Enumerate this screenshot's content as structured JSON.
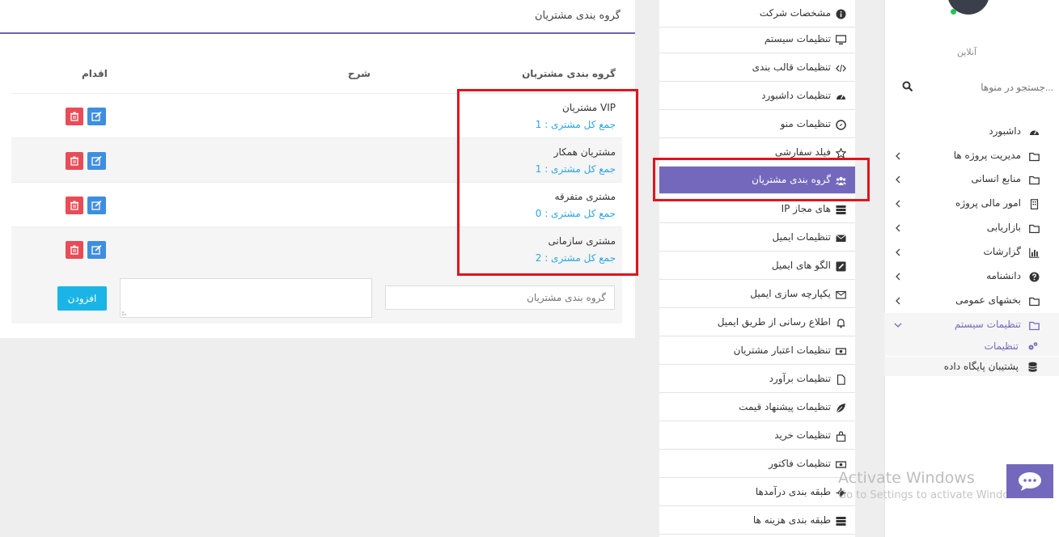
{
  "panel": {
    "title": "گروه بندی مشتریان",
    "columns": {
      "group": "گروه بندی مشتریان",
      "description": "شرح",
      "action": "اقدام"
    },
    "rows": [
      {
        "name": "مشتریان VIP",
        "count": "جمع کل مشتری : 1"
      },
      {
        "name": "مشتریان همکار",
        "count": "جمع کل مشتری : 1"
      },
      {
        "name": "مشتری متفرقه",
        "count": "جمع کل مشتری : 0"
      },
      {
        "name": "مشتری سازمانی",
        "count": "جمع کل مشتری : 2"
      }
    ],
    "form": {
      "name_placeholder": "گروه بندی مشتریان",
      "add_label": "افزودن"
    }
  },
  "settings_menu": {
    "items": [
      {
        "label": "مشخصات شرکت",
        "icon": "info-icon"
      },
      {
        "label": "تنظیمات سیستم",
        "icon": "monitor-icon"
      },
      {
        "label": "تنظیمات قالب بندی",
        "icon": "code-icon"
      },
      {
        "label": "تنظیمات داشبورد",
        "icon": "dashboard-icon"
      },
      {
        "label": "تنظیمات منو",
        "icon": "compass-icon"
      },
      {
        "label": "فیلد سفارشی",
        "icon": "star-icon"
      },
      {
        "label": "گروه بندی مشتریان",
        "icon": "users-icon",
        "active": true
      },
      {
        "label": "IP های مجاز",
        "icon": "server-icon"
      },
      {
        "label": "تنظیمات ایمیل",
        "icon": "envelope-icon"
      },
      {
        "label": "الگو های ایمیل",
        "icon": "edit-square-icon"
      },
      {
        "label": "یکپارچه سازی ایمیل",
        "icon": "envelope-outline-icon"
      },
      {
        "label": "اطلاع رسانی از طریق ایمیل",
        "icon": "bell-icon"
      },
      {
        "label": "تنظیمات اعتبار مشتریان",
        "icon": "money-icon"
      },
      {
        "label": "تنظیمات برآورد",
        "icon": "file-icon"
      },
      {
        "label": "تنظیمات پیشنهاد قیمت",
        "icon": "leaf-icon"
      },
      {
        "label": "تنظیمات خرید",
        "icon": "shopping-bag-icon"
      },
      {
        "label": "تنظیمات فاکتور",
        "icon": "money-icon"
      },
      {
        "label": "طبقه بندی درآمدها",
        "icon": "gear-icon"
      },
      {
        "label": "طبقه بندی هزینه ها",
        "icon": "server-icon"
      }
    ]
  },
  "sidebar": {
    "status": "آنلاین",
    "search_placeholder": "جستجو در منوها...",
    "items": [
      {
        "label": "داشبورد",
        "icon": "dashboard-icon"
      },
      {
        "label": "مدیریت پروژه ها",
        "icon": "folder-icon"
      },
      {
        "label": "منابع انسانی",
        "icon": "folder-icon"
      },
      {
        "label": "امور مالی پروژه",
        "icon": "building-icon"
      },
      {
        "label": "بازاریابی",
        "icon": "folder-icon"
      },
      {
        "label": "گزارشات",
        "icon": "bar-chart-icon"
      },
      {
        "label": "دانشنامه",
        "icon": "question-icon"
      },
      {
        "label": "بخشهای عمومی",
        "icon": "folder-icon"
      },
      {
        "label": "تنظیمات سیستم",
        "icon": "folder-icon",
        "expanded": true
      }
    ],
    "subitems": [
      {
        "label": "تنظیمات",
        "icon": "gears-icon",
        "active": true
      },
      {
        "label": "پشتیبان پایگاه داده",
        "icon": "database-icon"
      }
    ]
  },
  "watermark": {
    "title": "Activate Windows",
    "subtitle": "Go to Settings to activate Windows."
  },
  "colors": {
    "accent": "#7468bd",
    "link": "#29a6df",
    "danger": "#e84c57",
    "edit": "#3e8ee0",
    "add": "#1ab5e6",
    "highlight": "#e3131b"
  }
}
